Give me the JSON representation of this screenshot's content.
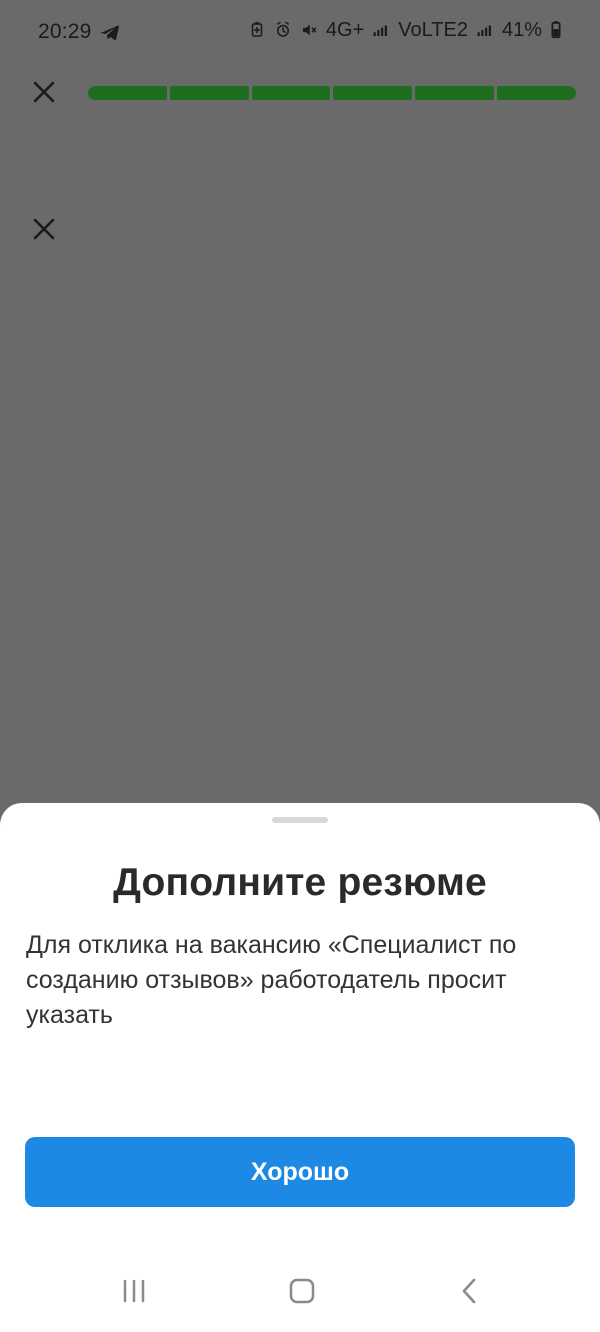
{
  "status_bar": {
    "time": "20:29",
    "network_primary": "4G+",
    "network_secondary": "VoLTE2",
    "battery": "41%",
    "icons": [
      "telegram-icon",
      "battery-saver-icon",
      "alarm-icon",
      "mute-icon",
      "signal-bars-icon",
      "battery-icon"
    ]
  },
  "top_bar": {
    "progress": {
      "segments": 6,
      "filled": 6,
      "accent": "#1f6e1f"
    },
    "close_icon": "close-icon"
  },
  "secondary_close": {
    "icon": "close-icon"
  },
  "sheet": {
    "title": "Дополните резюме",
    "text": "Для отклика на вакансию «Специалист по созданию отзывов» работодатель просит указать",
    "button": "Хорошо",
    "button_color": "#1e88e5"
  },
  "nav_bar": {
    "items": [
      {
        "name": "recent-apps",
        "icon": "recent-apps-icon"
      },
      {
        "name": "home",
        "icon": "home-icon"
      },
      {
        "name": "back",
        "icon": "back-icon"
      }
    ]
  }
}
